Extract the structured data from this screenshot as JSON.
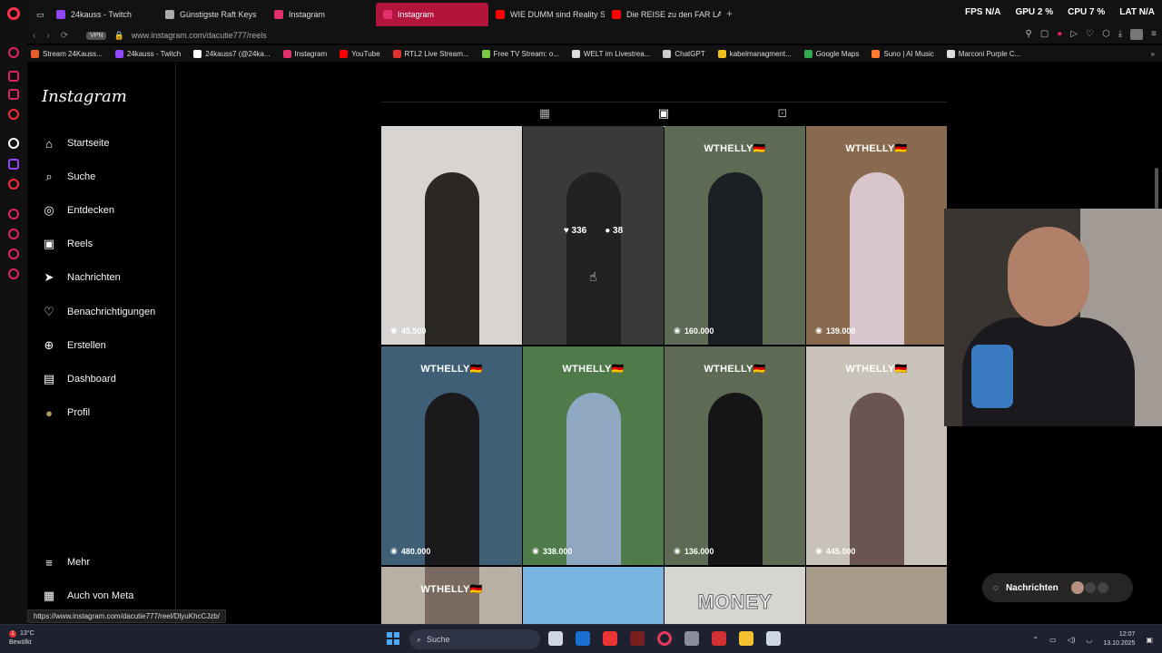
{
  "browser": {
    "tabs": [
      {
        "label": "24kauss - Twitch",
        "color": "#9146ff",
        "active": false
      },
      {
        "label": "Günstigste Raft Keys",
        "color": "#aaaaaa",
        "active": false
      },
      {
        "label": "Instagram",
        "color": "#e1306c",
        "active": false
      },
      {
        "label": "Instagram",
        "color": "#e1306c",
        "active": true
      },
      {
        "label": "WIE DUMM sind Reality S",
        "color": "#ff0000",
        "active": false
      },
      {
        "label": "Die REISE zu den FAR LA",
        "color": "#ff0000",
        "active": false
      }
    ],
    "new_tab": "+",
    "stats": [
      {
        "label": "FPS",
        "value": "N/A"
      },
      {
        "label": "GPU",
        "value": "2 %"
      },
      {
        "label": "CPU",
        "value": "7 %"
      },
      {
        "label": "LAT",
        "value": "N/A"
      }
    ],
    "vpn_label": "VPN",
    "url": "www.instagram.com/dacutie777/reels",
    "bookmarks": [
      {
        "label": "Stream 24Kauss...",
        "color": "#e85d2a"
      },
      {
        "label": "24kauss - Twitch",
        "color": "#9146ff"
      },
      {
        "label": "24kauss7 (@24ka...",
        "color": "#ffffff"
      },
      {
        "label": "Instagram",
        "color": "#e1306c"
      },
      {
        "label": "YouTube",
        "color": "#ff0000"
      },
      {
        "label": "RTL2 Live Stream...",
        "color": "#e03030"
      },
      {
        "label": "Free TV Stream: o...",
        "color": "#7ac943"
      },
      {
        "label": "WELT im Livestrea...",
        "color": "#dddddd"
      },
      {
        "label": "ChatGPT",
        "color": "#cccccc"
      },
      {
        "label": "kabelmanagment...",
        "color": "#f0c020"
      },
      {
        "label": "Google Maps",
        "color": "#34a853"
      },
      {
        "label": "Suno | AI Music",
        "color": "#ff7a2a"
      },
      {
        "label": "Marconi Purple C...",
        "color": "#dddddd"
      }
    ],
    "status_url": "https://www.instagram.com/dacutie777/reel/DlyuKhcCJzb/"
  },
  "instagram": {
    "logo": "Instagram",
    "nav": [
      {
        "label": "Startseite",
        "icon": "home-icon",
        "glyph": "⌂"
      },
      {
        "label": "Suche",
        "icon": "search-icon",
        "glyph": "⌕"
      },
      {
        "label": "Entdecken",
        "icon": "compass-icon",
        "glyph": "◎"
      },
      {
        "label": "Reels",
        "icon": "reels-icon",
        "glyph": "▣"
      },
      {
        "label": "Nachrichten",
        "icon": "send-icon",
        "glyph": "➤"
      },
      {
        "label": "Benachrichtigungen",
        "icon": "heart-icon",
        "glyph": "♡"
      },
      {
        "label": "Erstellen",
        "icon": "plus-icon",
        "glyph": "⊕"
      },
      {
        "label": "Dashboard",
        "icon": "dashboard-icon",
        "glyph": "▤"
      },
      {
        "label": "Profil",
        "icon": "avatar-icon",
        "glyph": "●"
      }
    ],
    "bottom_nav": [
      {
        "label": "Mehr",
        "icon": "menu-icon",
        "glyph": "≡"
      },
      {
        "label": "Auch von Meta",
        "icon": "meta-icon",
        "glyph": "▦"
      }
    ],
    "reels": [
      {
        "views": "45.500",
        "watermark": "",
        "bg": "#d7d4d2",
        "fig": "#2b2724"
      },
      {
        "views": "",
        "watermark": "",
        "bg": "#5a5a5a",
        "fig": "#222",
        "hover_likes": "336",
        "hover_comments": "38"
      },
      {
        "views": "160.000",
        "watermark": "WTHELLY🇩🇪",
        "bg": "#5d6a54",
        "fig": "#1c1f24"
      },
      {
        "views": "139.000",
        "watermark": "WTHELLY🇩🇪",
        "bg": "#8a6a4e",
        "fig": "#d9c6cc"
      },
      {
        "views": "480.000",
        "watermark": "WTHELLY🇩🇪",
        "bg": "#3e5f75",
        "fig": "#1a1a1d"
      },
      {
        "views": "338.000",
        "watermark": "WTHELLY🇩🇪",
        "bg": "#4f7a4a",
        "fig": "#8fa7c1"
      },
      {
        "views": "136.000",
        "watermark": "WTHELLY🇩🇪",
        "bg": "#5d6a54",
        "fig": "#151517"
      },
      {
        "views": "445.000",
        "watermark": "WTHELLY🇩🇪",
        "bg": "#c9c2b8",
        "fig": "#6b5550"
      },
      {
        "views": "",
        "watermark": "WTHELLY🇩🇪",
        "bg": "#b8b0a4",
        "fig": "#7a6a60"
      },
      {
        "views": "",
        "watermark": "",
        "bg": "#7ab4e0",
        "fig": "#7ab4e0"
      },
      {
        "views": "",
        "watermark": "MONEY",
        "bg": "#d6d6d0",
        "fig": "#d6d6d0"
      },
      {
        "views": "",
        "watermark": "",
        "bg": "#a89a88",
        "fig": "#a89a88"
      }
    ],
    "messages_pill": "Nachrichten"
  },
  "taskbar": {
    "temperature": "13°C",
    "weather_text": "Bewölkt",
    "notification_count": "1",
    "search_label": "Suche",
    "apps": [
      "#cfd6e4",
      "#1b6fd1",
      "#e33",
      "#7a1f1f",
      "#e63b5a",
      "#8a8fa0",
      "#d03030",
      "#f2c230",
      "#cfd6e4"
    ],
    "time": "12:07",
    "date": "13.10.2025"
  }
}
